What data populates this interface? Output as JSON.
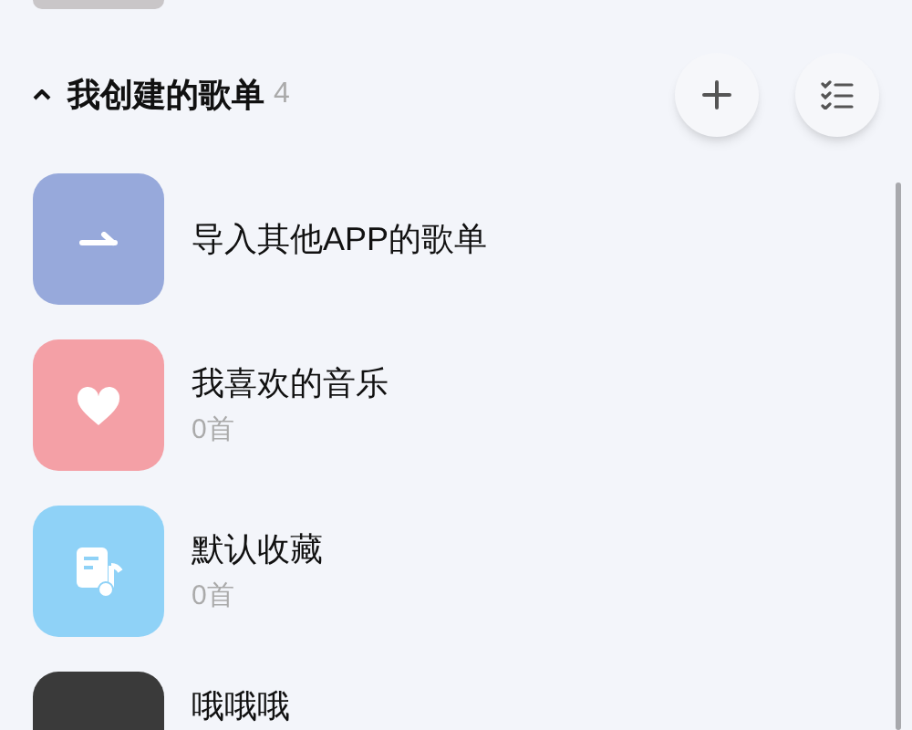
{
  "section": {
    "title": "我创建的歌单",
    "count": "4",
    "expanded": true
  },
  "playlists": [
    {
      "kind": "import",
      "title": "导入其他APP的歌单"
    },
    {
      "kind": "liked",
      "title": "我喜欢的音乐",
      "subtitle": "0首"
    },
    {
      "kind": "default",
      "title": "默认收藏",
      "subtitle": "0首"
    },
    {
      "kind": "photo",
      "title": "哦哦哦"
    }
  ]
}
